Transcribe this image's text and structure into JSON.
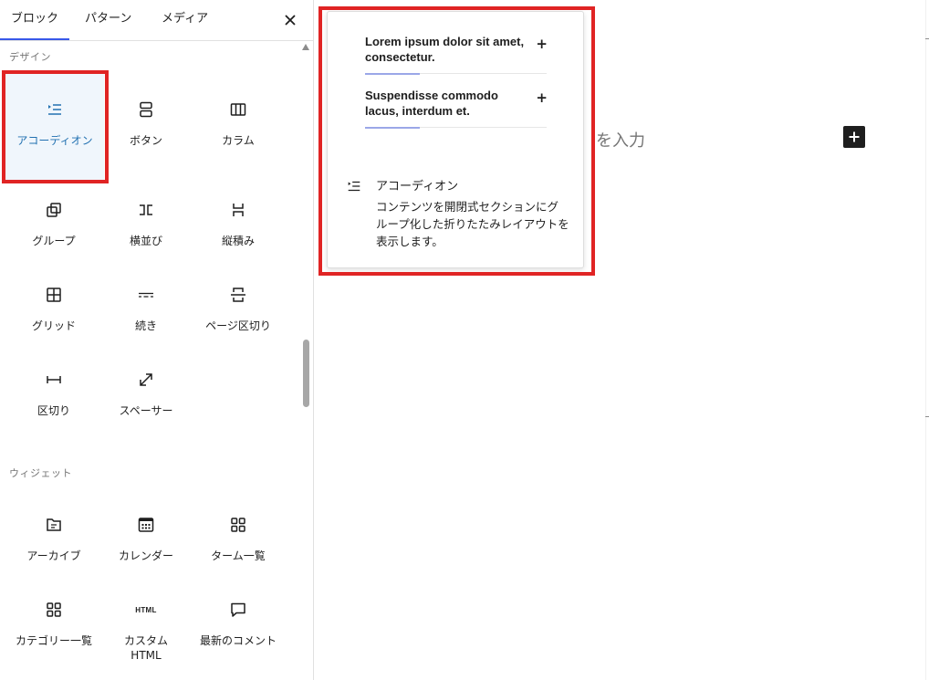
{
  "tabs": {
    "blocks": "ブロック",
    "patterns": "パターン",
    "media": "メディア",
    "close_icon": "close-icon"
  },
  "sections": {
    "design": "デザイン",
    "widgets": "ウィジェット"
  },
  "design_blocks": {
    "accordion": "アコーディオン",
    "buttons": "ボタン",
    "columns": "カラム",
    "group": "グループ",
    "row": "横並び",
    "stack": "縦積み",
    "grid": "グリッド",
    "more": "続き",
    "page_break": "ページ区切り",
    "separator": "区切り",
    "spacer": "スペーサー"
  },
  "widget_blocks": {
    "archives": "アーカイブ",
    "calendar": "カレンダー",
    "term_list": "ターム一覧",
    "categories": "カテゴリー一覧",
    "custom_html": "カスタム HTML",
    "html_icon_text": "HTML",
    "latest_comments": "最新のコメント"
  },
  "canvas": {
    "placeholder": "を入力"
  },
  "preview": {
    "item1": "Lorem ipsum dolor sit amet, consectetur.",
    "item2": "Suspendisse commodo lacus, interdum et.",
    "plus": "+",
    "title": "アコーディオン",
    "description": "コンテンツを開閉式セクションにグループ化した折りたたみレイアウトを表示します。"
  },
  "colors": {
    "highlight_border": "#e02424",
    "selected_label": "#2271b1",
    "selected_bg": "#f0f6fc",
    "tab_underline": "#3858e9"
  }
}
